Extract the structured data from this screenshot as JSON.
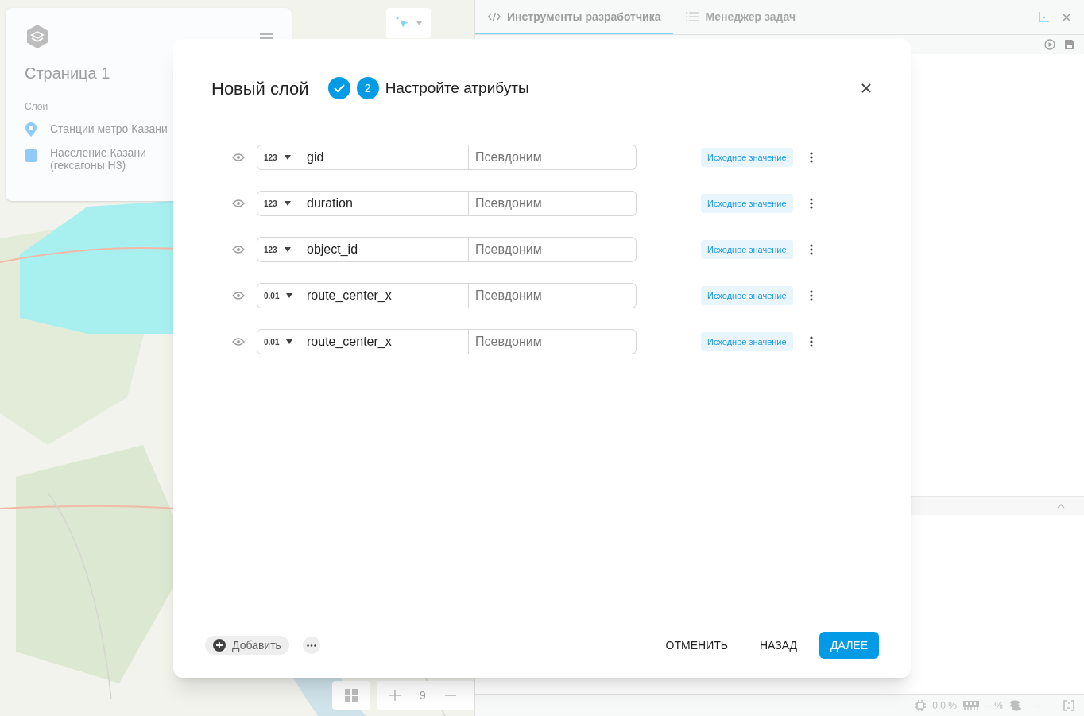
{
  "sidebar": {
    "title": "Страница 1",
    "section": "Слои",
    "layers": [
      {
        "kind": "point",
        "name": "Станции метро Казани",
        "color": "#90caf9"
      },
      {
        "kind": "polygon",
        "name": "Население Казани (гексагоны H3)",
        "color": "#90caf9"
      }
    ]
  },
  "map_controls": {
    "zoom": "9"
  },
  "devtools": {
    "tabs": [
      {
        "label": "Инструменты разработчика",
        "selected": true
      },
      {
        "label": "Менеджер задач",
        "selected": false
      }
    ],
    "status_bar": {
      "cpu": "0.0 %",
      "memory": "-- %",
      "disk": "--"
    }
  },
  "dialog": {
    "title": "Новый слой",
    "steps": [
      {
        "kind": "done"
      },
      {
        "kind": "current",
        "number": "2",
        "label": "Настройте атрибуты"
      }
    ],
    "attributes": [
      {
        "type": "123",
        "name": "gid",
        "alias_placeholder": "Псевдоним",
        "default_button": "Исходное значение"
      },
      {
        "type": "123",
        "name": "duration",
        "alias_placeholder": "Псевдоним",
        "default_button": "Исходное значение"
      },
      {
        "type": "123",
        "name": "object_id",
        "alias_placeholder": "Псевдоним",
        "default_button": "Исходное значение"
      },
      {
        "type": "0.01",
        "name": "route_center_x",
        "alias_placeholder": "Псевдоним",
        "default_button": "Исходное значение"
      },
      {
        "type": "0.01",
        "name": "route_center_x",
        "alias_placeholder": "Псевдоним",
        "default_button": "Исходное значение"
      }
    ],
    "add_button": "Добавить",
    "buttons": {
      "cancel": "ОТМЕНИТЬ",
      "back": "НАЗАД",
      "next": "ДАЛЕЕ"
    }
  }
}
